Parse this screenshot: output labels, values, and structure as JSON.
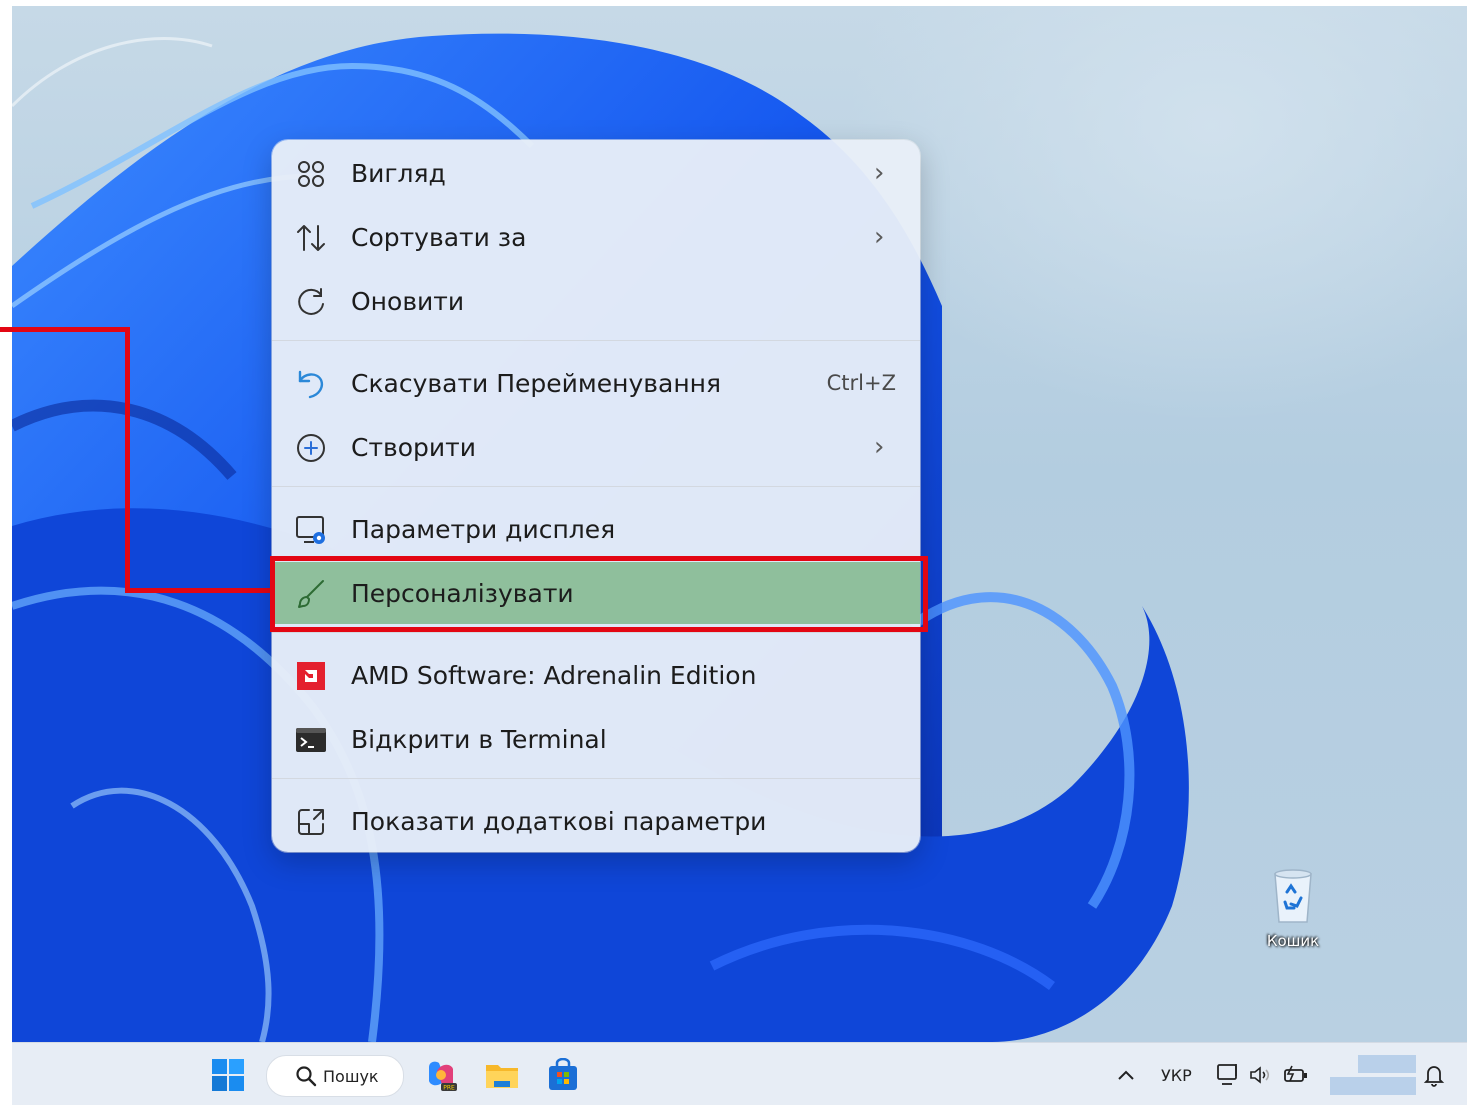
{
  "context_menu": {
    "items": [
      {
        "label": "Вигляд",
        "icon": "grid-view-icon",
        "submenu": true
      },
      {
        "label": "Сортувати за",
        "icon": "sort-icon",
        "submenu": true
      },
      {
        "label": "Оновити",
        "icon": "refresh-icon",
        "submenu": false
      },
      {
        "label": "Скасувати Перейменування",
        "icon": "undo-icon",
        "shortcut": "Ctrl+Z"
      },
      {
        "label": "Створити",
        "icon": "add-circle-icon",
        "submenu": true
      },
      {
        "label": "Параметри дисплея",
        "icon": "display-settings-icon"
      },
      {
        "label": "Персоналізувати",
        "icon": "brush-icon",
        "highlighted": true
      },
      {
        "label": "AMD Software: Adrenalin Edition",
        "icon": "amd-icon"
      },
      {
        "label": "Відкрити в Terminal",
        "icon": "terminal-icon"
      },
      {
        "label": "Показати додаткові параметри",
        "icon": "more-options-icon"
      }
    ]
  },
  "desktop": {
    "recycle_bin_label": "Кошик"
  },
  "taskbar": {
    "search_label": "Пошук",
    "language": "УКР",
    "icons": [
      "start-icon",
      "search-icon",
      "copilot-icon",
      "file-explorer-icon",
      "store-icon",
      "chevron-up-icon",
      "network-icon",
      "volume-icon",
      "battery-icon",
      "notification-bell-icon"
    ]
  },
  "colors": {
    "highlight": "#8fbf9c",
    "annotation_red": "#e30613",
    "wallpaper_blue": "#1a5cf0"
  }
}
